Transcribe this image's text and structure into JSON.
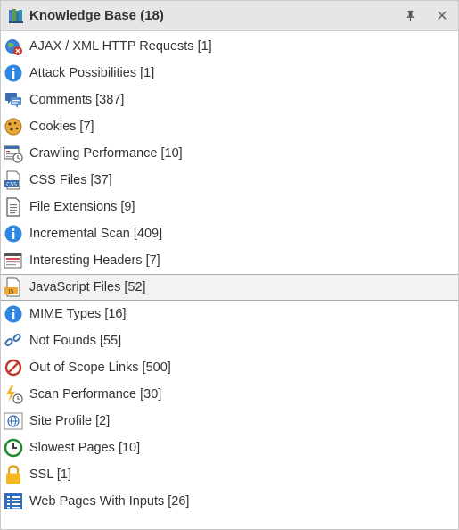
{
  "panel": {
    "title": "Knowledge Base (18)",
    "pin_glyph": "📌",
    "close_glyph": "✕"
  },
  "items": [
    {
      "label": "AJAX / XML HTTP Requests [1]",
      "icon": "ajax-globe-icon"
    },
    {
      "label": "Attack Possibilities [1]",
      "icon": "info-icon"
    },
    {
      "label": "Comments [387]",
      "icon": "comments-icon"
    },
    {
      "label": "Cookies [7]",
      "icon": "cookie-icon"
    },
    {
      "label": "Crawling Performance [10]",
      "icon": "crawl-performance-icon"
    },
    {
      "label": "CSS Files [37]",
      "icon": "css-file-icon"
    },
    {
      "label": "File Extensions [9]",
      "icon": "document-icon"
    },
    {
      "label": "Incremental Scan [409]",
      "icon": "info-icon"
    },
    {
      "label": "Interesting Headers [7]",
      "icon": "headers-icon"
    },
    {
      "label": "JavaScript Files [52]",
      "icon": "js-file-icon",
      "selected": true
    },
    {
      "label": "MIME Types [16]",
      "icon": "info-icon"
    },
    {
      "label": "Not Founds [55]",
      "icon": "broken-link-icon"
    },
    {
      "label": "Out of Scope Links [500]",
      "icon": "no-entry-icon"
    },
    {
      "label": "Scan Performance [30]",
      "icon": "lightning-clock-icon"
    },
    {
      "label": "Site Profile [2]",
      "icon": "site-profile-icon"
    },
    {
      "label": "Slowest Pages [10]",
      "icon": "clock-icon"
    },
    {
      "label": "SSL [1]",
      "icon": "lock-icon"
    },
    {
      "label": "Web Pages With Inputs [26]",
      "icon": "form-list-icon"
    }
  ]
}
